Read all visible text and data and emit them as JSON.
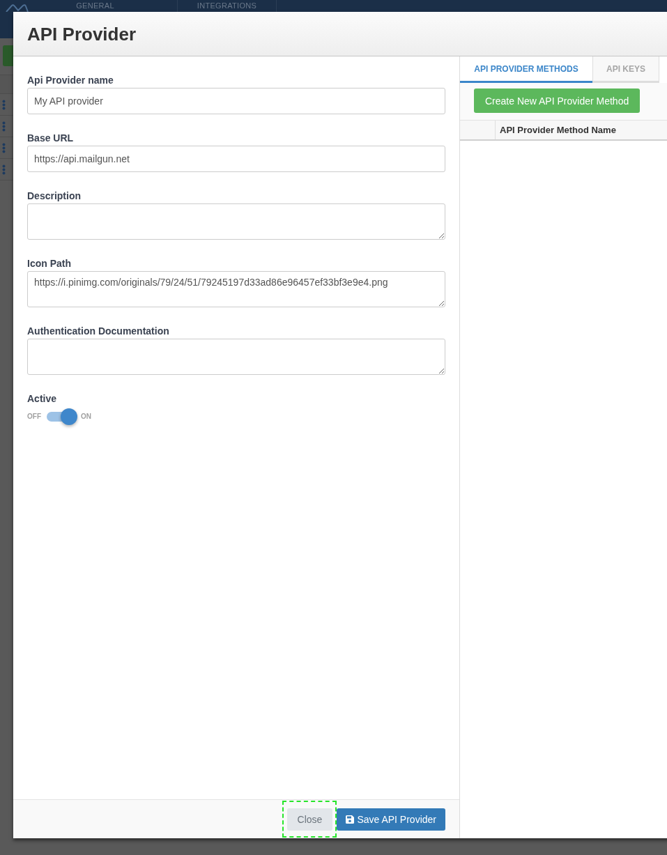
{
  "background_page": {
    "nav_tabs": [
      "GENERAL",
      "INTEGRATIONS"
    ]
  },
  "modal": {
    "title": "API Provider",
    "fields": [
      {
        "kind": "input",
        "label": "Api Provider name",
        "value": "My API provider"
      },
      {
        "kind": "input",
        "label": "Base URL",
        "value": "https://api.mailgun.net"
      },
      {
        "kind": "textarea",
        "label": "Description"
      },
      {
        "kind": "textarea",
        "label": "Icon Path",
        "value": "https://i.pinimg.com/originals/79/24/51/79245197d33ad86e96457ef33bf3e9e4.png"
      },
      {
        "kind": "textarea",
        "label": "Authentication Documentation"
      }
    ],
    "active": {
      "label": "Active",
      "off_label": "OFF",
      "on_label": "ON",
      "on": true
    },
    "footer": {
      "buttons": [
        {
          "kind": "secondary",
          "label": "Close",
          "highlighted": true
        },
        {
          "kind": "primary",
          "label": "Save API Provider"
        }
      ]
    }
  },
  "side_panel": {
    "tabs": [
      {
        "label": "API PROVIDER METHODS",
        "selected": true
      },
      {
        "label": "API KEYS",
        "selected": false
      }
    ],
    "create_button": "Create New API Provider Method",
    "table": {
      "columns": [
        {
          "label": "API Provider Method Name"
        }
      ]
    }
  }
}
